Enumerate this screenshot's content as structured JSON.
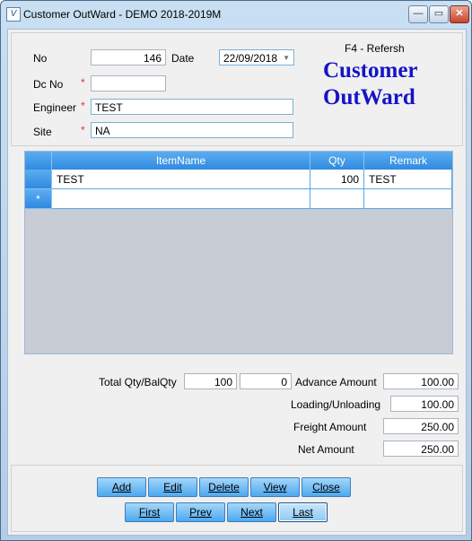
{
  "window": {
    "title": "Customer OutWard - DEMO 2018-2019M",
    "icon": "app-icon",
    "minimize_icon": "minimize-icon",
    "maximize_icon": "maximize-icon",
    "close_icon": "close-icon"
  },
  "header": {
    "no_label": "No",
    "no_value": "146",
    "date_label": "Date",
    "date_value": "22/09/2018",
    "dcno_label": "Dc No",
    "dcno_value": "",
    "engineer_label": "Engineer",
    "engineer_value": "TEST",
    "site_label": "Site",
    "site_value": "NA",
    "required_mark": "*",
    "refresh_hint": "F4 - Refersh",
    "form_title_line1": "Customer",
    "form_title_line2": "OutWard"
  },
  "grid": {
    "columns": [
      "ItemName",
      "Qty",
      "Remark"
    ],
    "rows": [
      {
        "item": "TEST",
        "qty": "100",
        "remark": "TEST"
      }
    ],
    "new_row_marker": "*"
  },
  "totals": {
    "total_label": "Total Qty/BalQty",
    "total_qty": "100",
    "bal_qty": "0",
    "advance_label": "Advance Amount",
    "advance_value": "100.00",
    "loading_label": "Loading/Unloading",
    "loading_value": "100.00",
    "freight_label": "Freight Amount",
    "freight_value": "250.00",
    "net_label": "Net Amount",
    "net_value": "250.00"
  },
  "buttons": {
    "add": "Add",
    "edit": "Edit",
    "delete": "Delete",
    "view": "View",
    "close": "Close",
    "first": "First",
    "prev": "Prev",
    "next": "Next",
    "last": "Last"
  },
  "colors": {
    "accent": "#2f8ae0",
    "title_blue": "#1414c8",
    "required": "#e03030"
  }
}
